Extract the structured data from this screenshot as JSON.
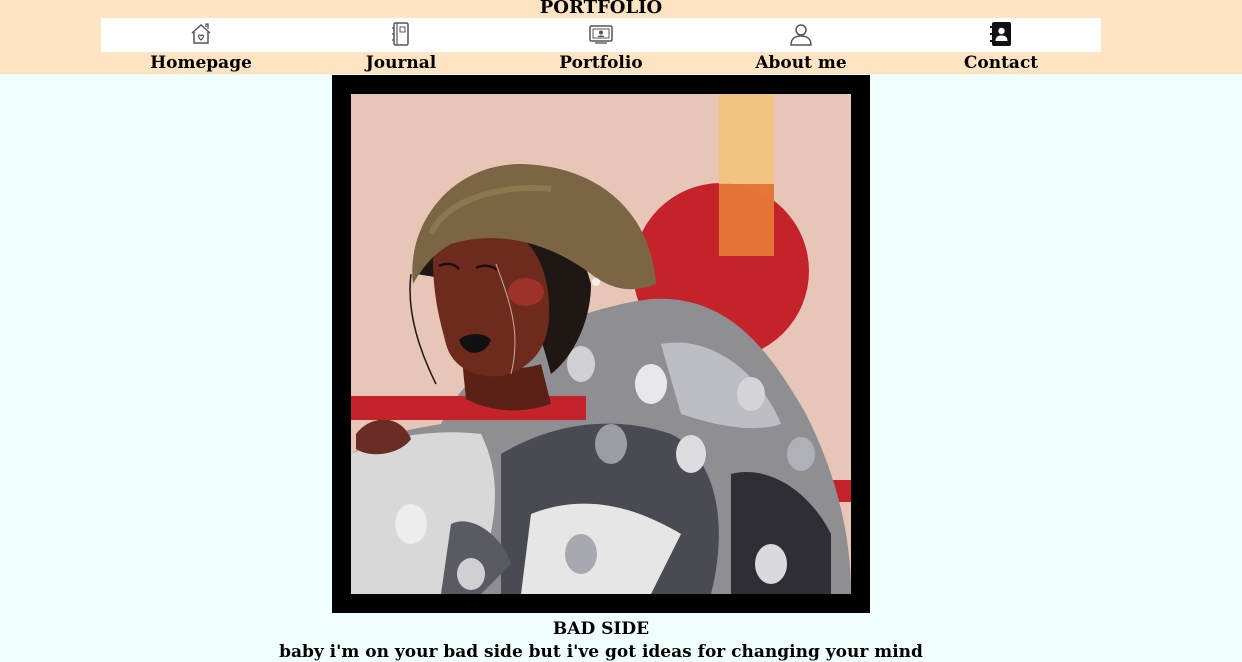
{
  "header": {
    "title": "PORTFOLIO",
    "background_color": "#ffe4c4"
  },
  "nav": {
    "items": [
      {
        "label": "Homepage",
        "icon": "house-heart-icon"
      },
      {
        "label": "Journal",
        "icon": "notebook-icon"
      },
      {
        "label": "Portfolio",
        "icon": "portfolio-screen-icon"
      },
      {
        "label": "About me",
        "icon": "person-icon"
      },
      {
        "label": "Contact",
        "icon": "contact-book-icon"
      }
    ]
  },
  "artwork": {
    "title": "BAD SIDE",
    "caption": "baby i'm on your bad side but i've got ideas for changing your mind",
    "frame_color": "#000000"
  },
  "page": {
    "background_color": "#f0fffd"
  }
}
